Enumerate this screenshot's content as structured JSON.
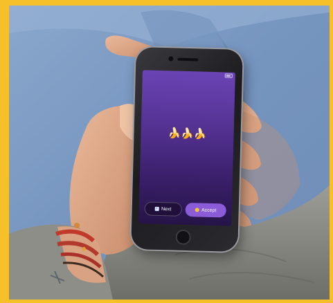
{
  "status_bar": {
    "carrier": "",
    "time": "",
    "battery": ""
  },
  "screen": {
    "emoji": "🍌🍌🍌",
    "message": ""
  },
  "buttons": {
    "next_label": "Next",
    "accept_label": "Accept"
  },
  "colors": {
    "frame": "#f5c02a",
    "screen_top": "#6a44b4",
    "screen_bottom": "#251447",
    "accept_button": "#8a5cd8"
  },
  "icons": {
    "next": "next-arrow-icon",
    "accept": "accept-emoji-icon",
    "battery": "battery-icon"
  }
}
